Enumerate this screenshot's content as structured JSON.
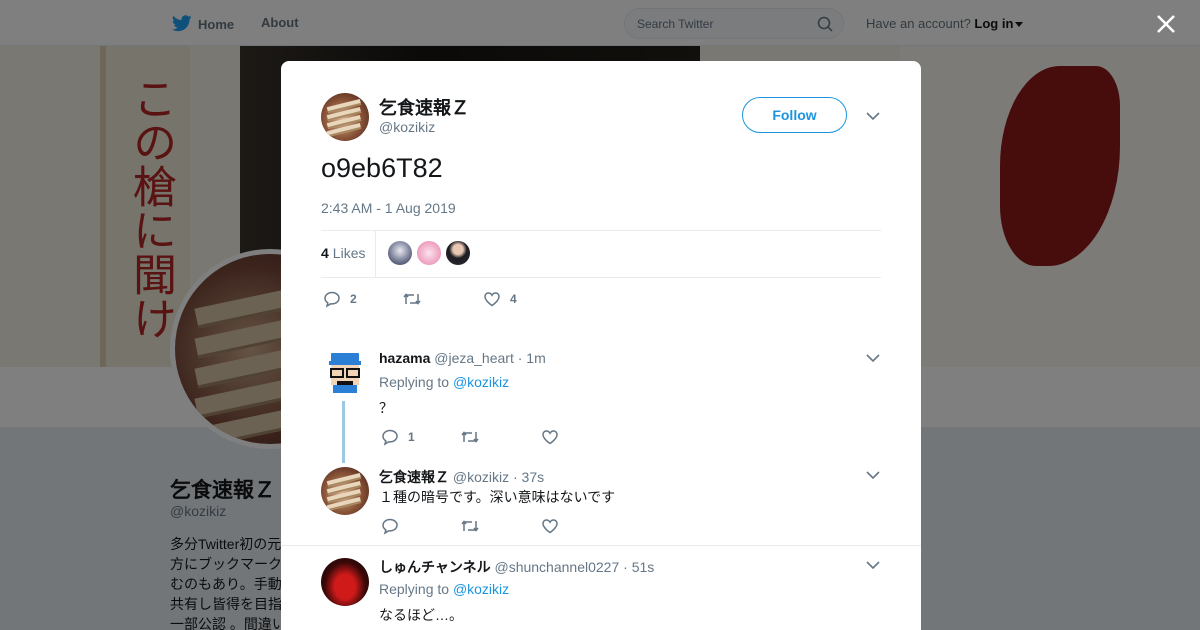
{
  "nav": {
    "home_label": "Home",
    "about_label": "About",
    "search_placeholder": "Search Twitter",
    "account_text": "Have an account?",
    "login_label": "Log in"
  },
  "profile": {
    "name": "乞食速報Ｚ",
    "handle": "@kozikiz",
    "bio": "多分Twitter初の元\n方にブックマーク\nむのもあり。手動\n共有し皆得を目指\n一部公認 。間違い",
    "banner_text": "この槍に聞け"
  },
  "tweet": {
    "author_name": "乞食速報Ｚ",
    "author_handle": "@kozikiz",
    "follow_label": "Follow",
    "text": "o9eb6T82",
    "timestamp": "2:43 AM - 1 Aug 2019",
    "likes_count": "4",
    "likes_label": "Likes",
    "reply_count": "2",
    "retweet_count": "",
    "like_count": "4"
  },
  "replies": [
    {
      "name": "hazama",
      "handle": "@jeza_heart",
      "time": "· 1m",
      "replying_label": "Replying to",
      "replying_to": "@kozikiz",
      "text": "？",
      "reply_count": "1",
      "retweet_count": "",
      "like_count": ""
    },
    {
      "name": "乞食速報Ｚ",
      "handle": "@kozikiz",
      "time": "· 37s",
      "text": "１種の暗号です。深い意味はないです",
      "reply_count": "",
      "retweet_count": "",
      "like_count": ""
    },
    {
      "name": "しゅんチャンネル",
      "handle": "@shunchannel0227",
      "time": "· 51s",
      "replying_label": "Replying to",
      "replying_to": "@kozikiz",
      "text": "なるほど…。"
    }
  ],
  "colors": {
    "brand_blue": "#1da1f2",
    "link_blue": "#1b95e0",
    "muted": "#657786",
    "thread_line": "#9cc8e4"
  },
  "icons": [
    "twitter-bird-icon",
    "search-icon",
    "close-icon",
    "chevron-down-icon",
    "reply-icon",
    "retweet-icon",
    "heart-icon"
  ]
}
